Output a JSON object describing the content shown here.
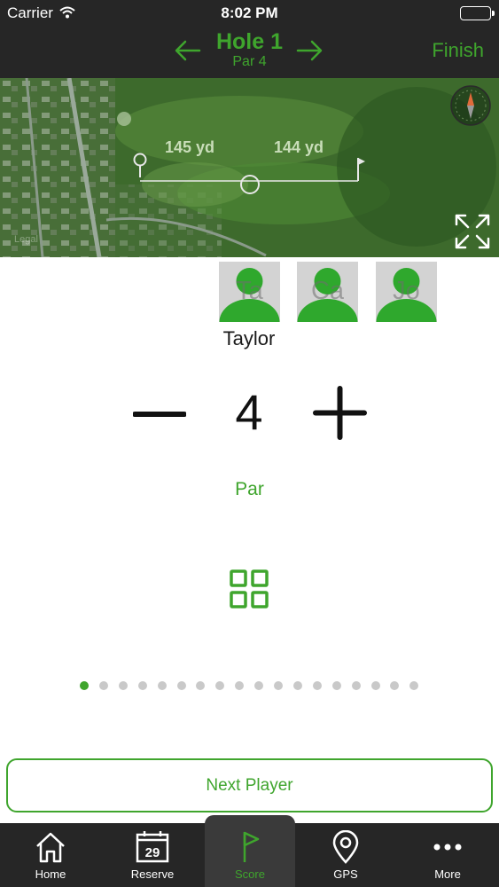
{
  "status_bar": {
    "carrier": "Carrier",
    "time": "8:02 PM"
  },
  "header": {
    "hole_title": "Hole 1",
    "hole_par": "Par 4",
    "finish_label": "Finish"
  },
  "map": {
    "distance_1": "145 yd",
    "distance_2": "144 yd",
    "legal_label": "Legal"
  },
  "players": [
    {
      "initials": "Ta"
    },
    {
      "initials": "Ca"
    },
    {
      "initials": "Jo"
    }
  ],
  "current_player": {
    "name": "Taylor"
  },
  "score": {
    "value": "4",
    "label": "Par"
  },
  "pagination": {
    "total": 18,
    "current": 1
  },
  "next_player_label": "Next Player",
  "tabs": [
    {
      "label": "Home",
      "icon": "home-icon"
    },
    {
      "label": "Reserve",
      "icon": "calendar-icon",
      "badge": "29"
    },
    {
      "label": "Score",
      "icon": "flag-icon"
    },
    {
      "label": "GPS",
      "icon": "location-pin-icon"
    },
    {
      "label": "More",
      "icon": "more-dots-icon"
    }
  ],
  "colors": {
    "accent": "#3fa52d",
    "bar_bg": "#262626",
    "active_tab_bg": "#3a3a3a"
  }
}
